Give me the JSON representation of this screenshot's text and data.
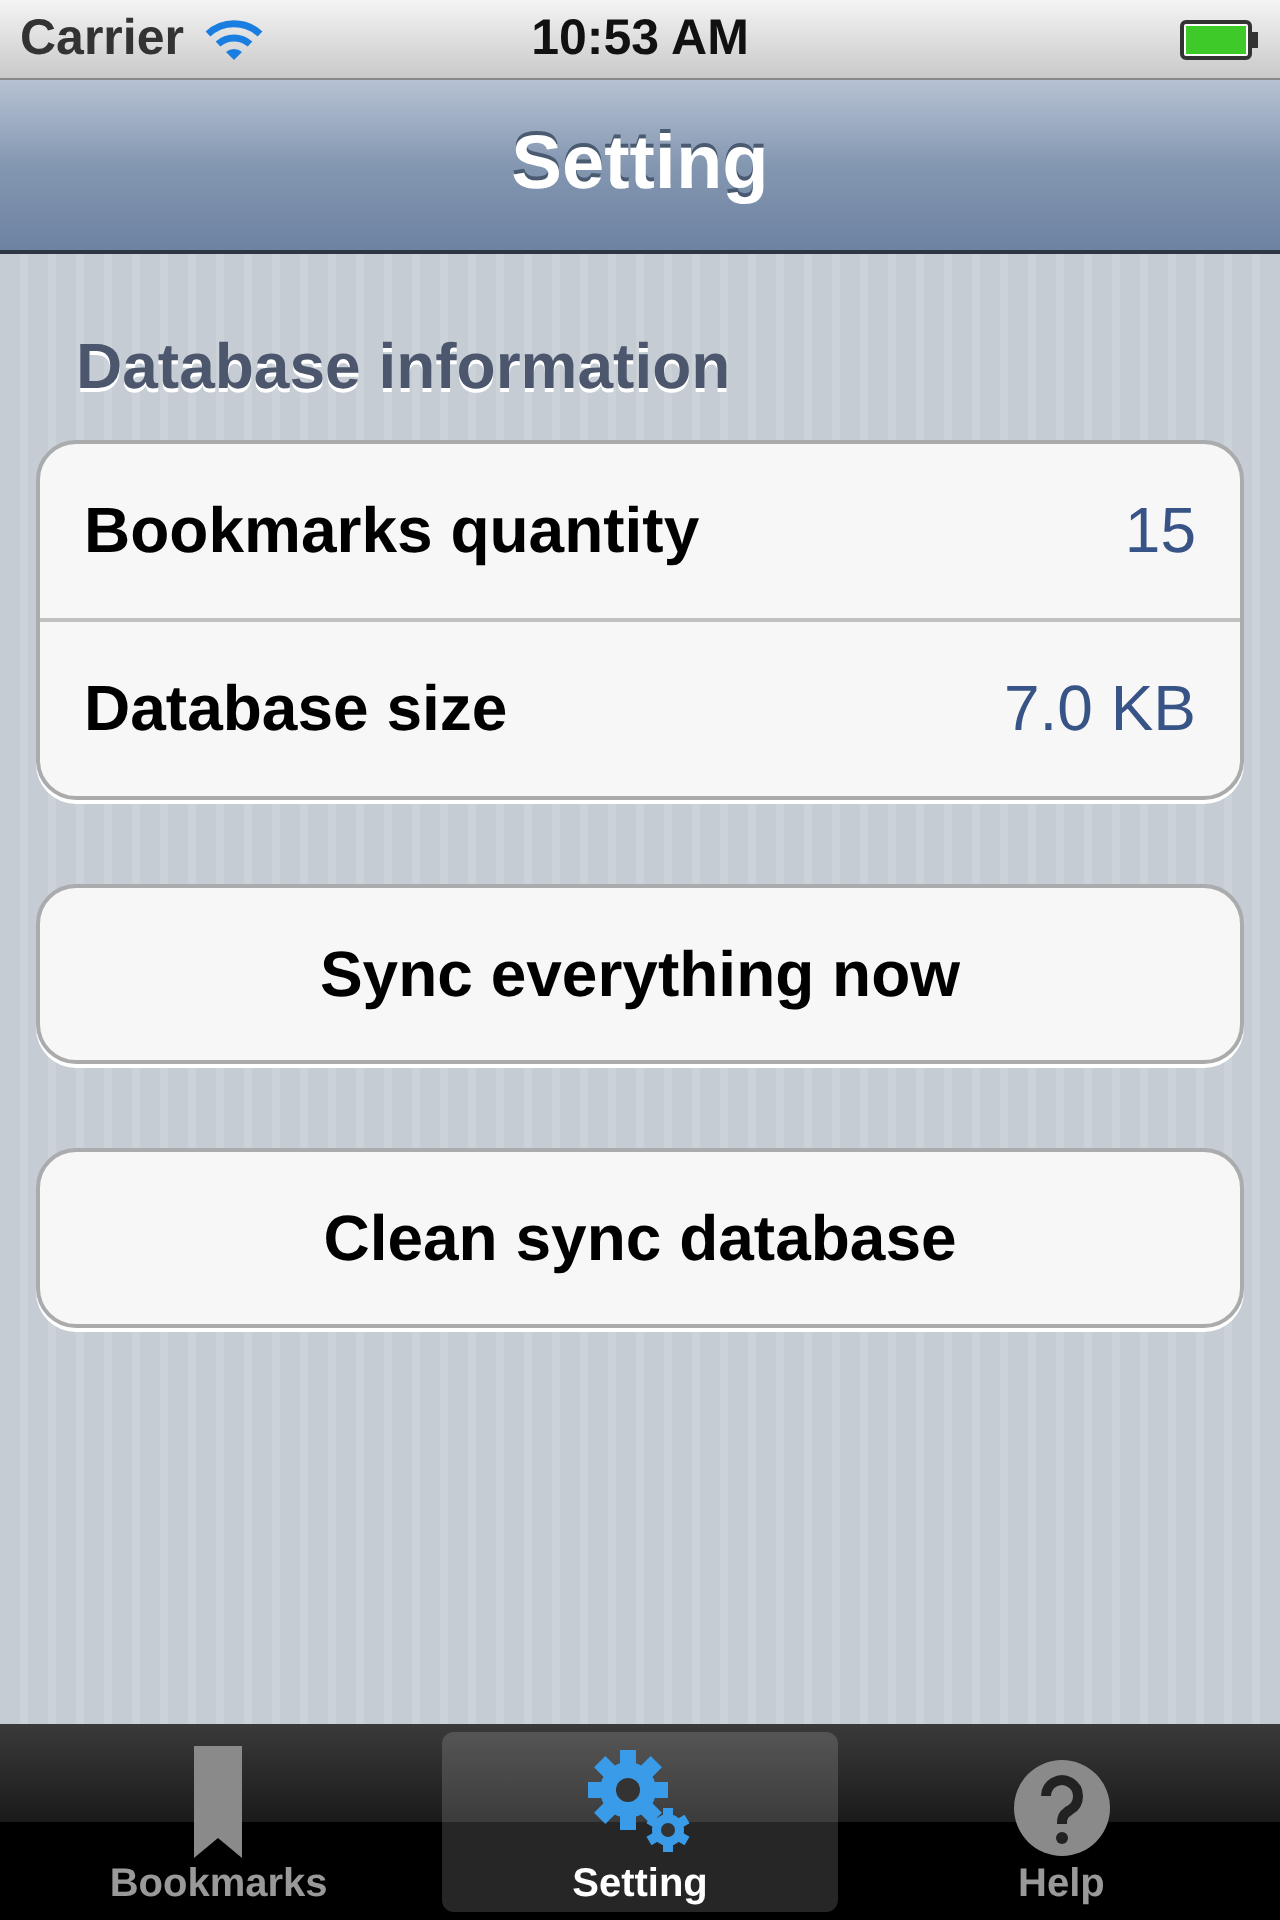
{
  "status_bar": {
    "carrier": "Carrier",
    "time": "10:53 AM"
  },
  "nav_bar": {
    "title": "Setting"
  },
  "section": {
    "header": "Database information",
    "rows": [
      {
        "label": "Bookmarks quantity",
        "value": "15"
      },
      {
        "label": "Database size",
        "value": "7.0 KB"
      }
    ]
  },
  "buttons": [
    "Sync everything now",
    "Clean sync database"
  ],
  "tabs": [
    {
      "label": "Bookmarks",
      "kind": "bookmark",
      "selected": false
    },
    {
      "label": "Setting",
      "kind": "gear",
      "selected": true
    },
    {
      "label": "Help",
      "kind": "help",
      "selected": false
    }
  ]
}
